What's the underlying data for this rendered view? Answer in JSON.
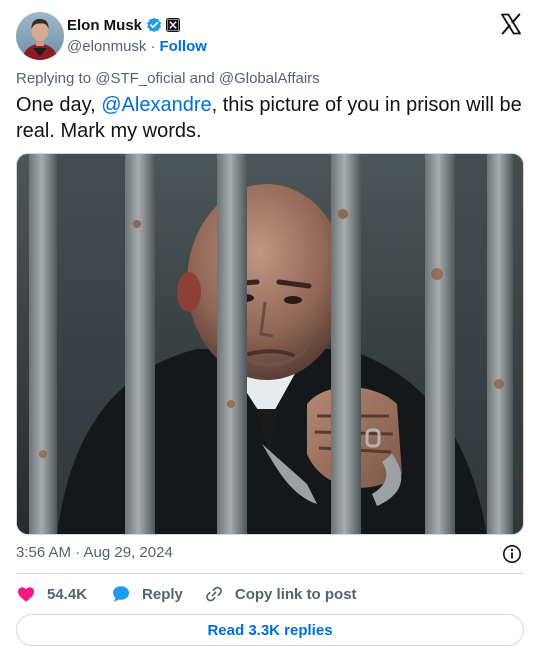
{
  "author": {
    "name": "Elon Musk",
    "handle": "@elonmusk",
    "separator": "·",
    "follow_label": "Follow"
  },
  "reply_context": {
    "prefix": "Replying to ",
    "users": [
      "@STF_oficial",
      "@GlobalAffairs"
    ],
    "joiner": " and "
  },
  "tweet": {
    "text_before": "One day, ",
    "mention": "@Alexandre",
    "text_after": ", this picture of you in prison will be real. Mark my words.",
    "timestamp": "3:56 AM · Aug 29, 2024"
  },
  "actions": {
    "likes": "54.4K",
    "reply_label": "Reply",
    "copy_label": "Copy link to post"
  },
  "read_replies_label": "Read 3.3K replies",
  "colors": {
    "link": "#006fd6",
    "like": "#f91880",
    "verified": "#1d9bf0",
    "muted": "#536471",
    "border": "#cfd9de"
  },
  "icons": {
    "verified": "verified-badge-icon",
    "affiliate": "x-affiliate-badge-icon",
    "platform": "x-logo-icon",
    "info": "info-icon",
    "like": "heart-icon",
    "reply": "reply-bubble-icon",
    "copy": "link-icon"
  }
}
